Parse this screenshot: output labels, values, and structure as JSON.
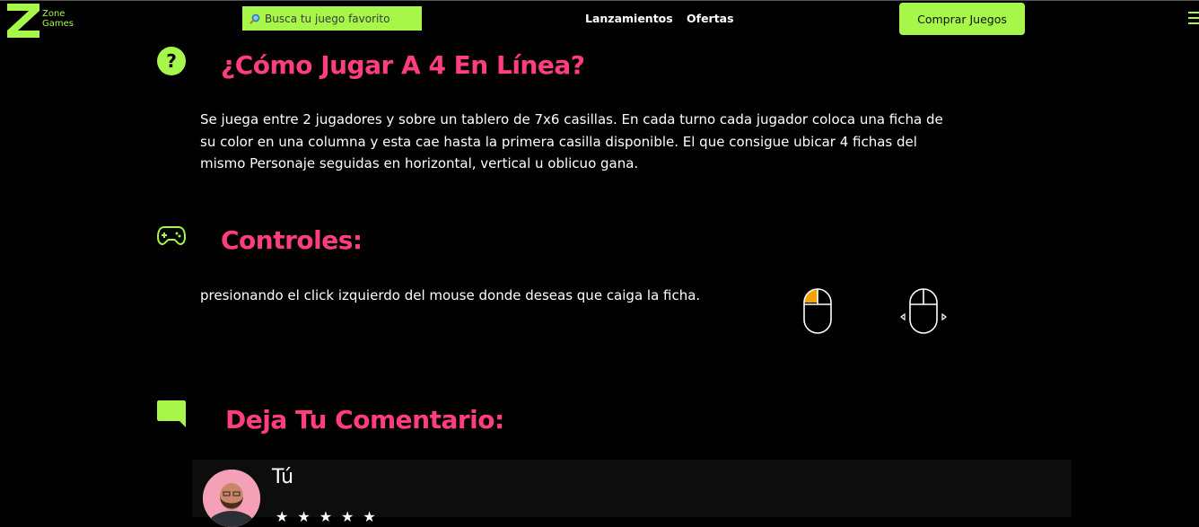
{
  "header": {
    "logo_line1": "Zone",
    "logo_line2": "Games",
    "search_placeholder": "Busca tu juego favorito",
    "nav": [
      "Lanzamientos",
      "Ofertas"
    ],
    "buy_button": "Comprar Juegos",
    "icons": {
      "search": "magnifier-icon",
      "menu": "hamburger-icon"
    }
  },
  "how_to_play": {
    "title": "¿Cómo Jugar A 4 En Línea?",
    "text": "Se juega entre 2 jugadores y sobre un tablero de 7x6 casillas. En cada turno cada jugador coloca una ficha de su color en una columna y esta cae hasta la primera casilla disponible. El que consigue ubicar 4 fichas del mismo Personaje seguidas en horizontal, vertical u oblicuo gana.",
    "icon": "help-icon"
  },
  "controls": {
    "title": "Controles:",
    "text": "presionando el click izquierdo del mouse donde deseas que caiga la ficha.",
    "icon": "gamepad-icon",
    "mouse_icons": [
      "mouse-left-click-icon",
      "mouse-move-icon"
    ]
  },
  "comments": {
    "title": "Deja Tu Comentario:",
    "icon": "comment-icon",
    "user_name": "Tú",
    "stars": "★★★★★"
  },
  "colors": {
    "accent_green": "#a6f74a",
    "title_pink": "#ff3d7f",
    "mouse_click": "#f5a300",
    "background": "#000000"
  }
}
